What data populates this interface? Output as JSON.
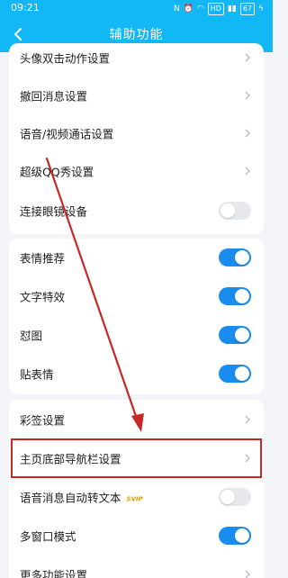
{
  "status": {
    "time": "09:21",
    "network": "HD",
    "battery": "67"
  },
  "header": {
    "title": "辅助功能"
  },
  "colors": {
    "header": "#12b7f5",
    "toggle_on": "#1a8cf0",
    "highlight": "#c62828"
  },
  "groups": [
    {
      "items": [
        {
          "label": "头像双击动作设置",
          "control": "chevron"
        },
        {
          "label": "撤回消息设置",
          "control": "chevron"
        },
        {
          "label": "语音/视频通话设置",
          "control": "chevron"
        },
        {
          "label": "超级QQ秀设置",
          "control": "chevron"
        },
        {
          "label": "连接眼镜设备",
          "control": "toggle",
          "on": false
        }
      ]
    },
    {
      "items": [
        {
          "label": "表情推荐",
          "control": "toggle",
          "on": true
        },
        {
          "label": "文字特效",
          "control": "toggle",
          "on": true
        },
        {
          "label": "怼图",
          "control": "toggle",
          "on": true
        },
        {
          "label": "贴表情",
          "control": "toggle",
          "on": true
        }
      ]
    },
    {
      "items": [
        {
          "label": "彩签设置",
          "control": "chevron"
        },
        {
          "label": "主页底部导航栏设置",
          "control": "chevron",
          "highlighted": true
        },
        {
          "label": "语音消息自动转文本",
          "badge": "SVIP",
          "control": "toggle",
          "on": false
        },
        {
          "label": "多窗口模式",
          "control": "toggle",
          "on": true
        },
        {
          "label": "更多功能设置",
          "control": "chevron"
        }
      ]
    }
  ]
}
